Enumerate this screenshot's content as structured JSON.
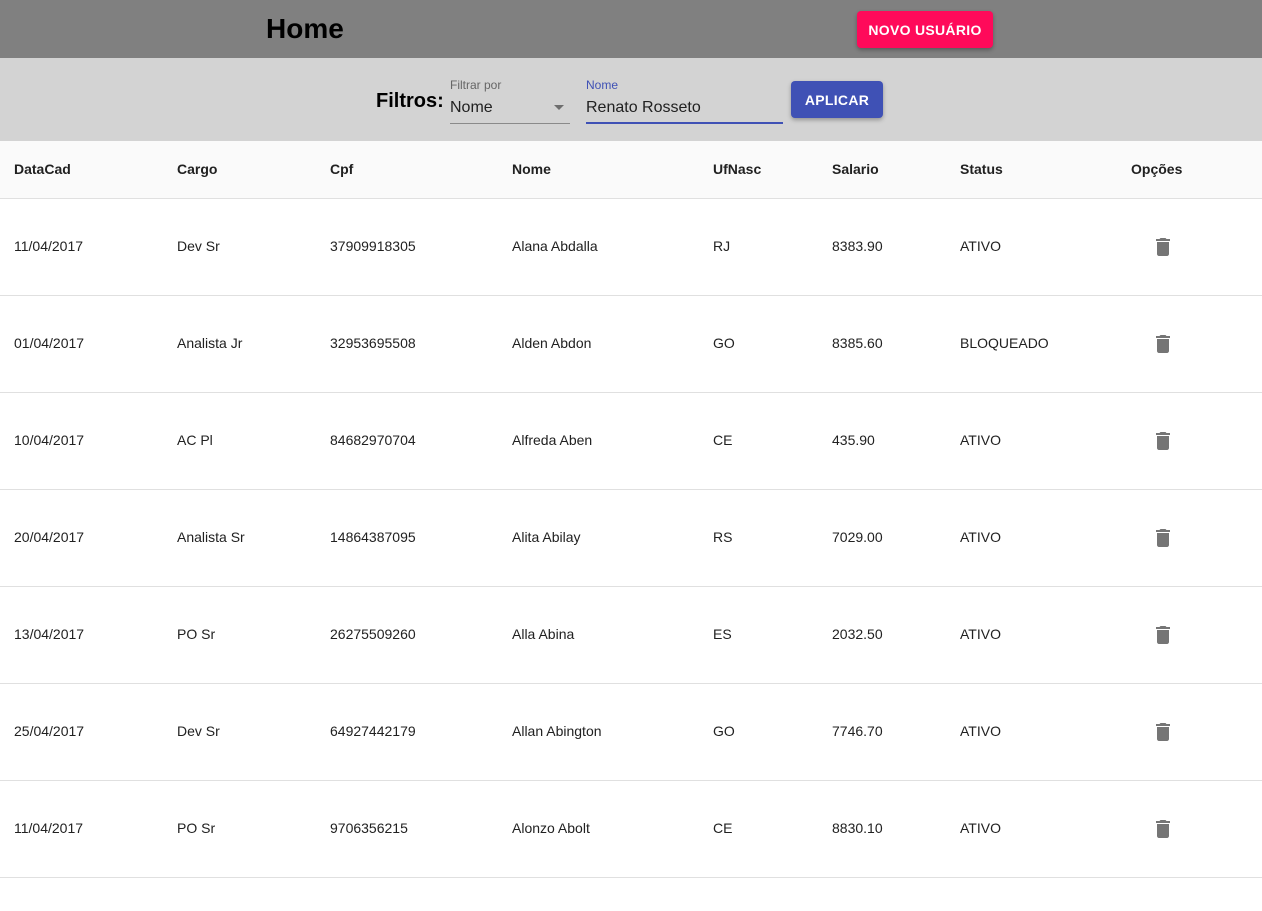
{
  "header": {
    "title": "Home",
    "new_user_label": "NOVO USUÁRIO"
  },
  "filters": {
    "label": "Filtros:",
    "filter_by_label": "Filtrar por",
    "filter_by_value": "Nome",
    "name_label": "Nome",
    "name_value": "Renato Rosseto",
    "apply_label": "APLICAR"
  },
  "table": {
    "columns": [
      "DataCad",
      "Cargo",
      "Cpf",
      "Nome",
      "UfNasc",
      "Salario",
      "Status",
      "Opções"
    ],
    "rows": [
      [
        "11/04/2017",
        "Dev Sr",
        "37909918305",
        "Alana Abdalla",
        "RJ",
        "8383.90",
        "ATIVO"
      ],
      [
        "01/04/2017",
        "Analista Jr",
        "32953695508",
        "Alden Abdon",
        "GO",
        "8385.60",
        "BLOQUEADO"
      ],
      [
        "10/04/2017",
        "AC Pl",
        "84682970704",
        "Alfreda Aben",
        "CE",
        "435.90",
        "ATIVO"
      ],
      [
        "20/04/2017",
        "Analista Sr",
        "14864387095",
        "Alita Abilay",
        "RS",
        "7029.00",
        "ATIVO"
      ],
      [
        "13/04/2017",
        "PO Sr",
        "26275509260",
        "Alla Abina",
        "ES",
        "2032.50",
        "ATIVO"
      ],
      [
        "25/04/2017",
        "Dev Sr",
        "64927442179",
        "Allan Abington",
        "GO",
        "7746.70",
        "ATIVO"
      ],
      [
        "11/04/2017",
        "PO Sr",
        "9706356215",
        "Alonzo Abolt",
        "CE",
        "8830.10",
        "ATIVO"
      ]
    ],
    "row_action_icon": "delete-icon"
  },
  "colors": {
    "topbar": "#808080",
    "filterbar": "#d3d3d3",
    "new_user_button": "#ff0a5a",
    "primary": "#3f51b5",
    "icon": "#757575"
  }
}
